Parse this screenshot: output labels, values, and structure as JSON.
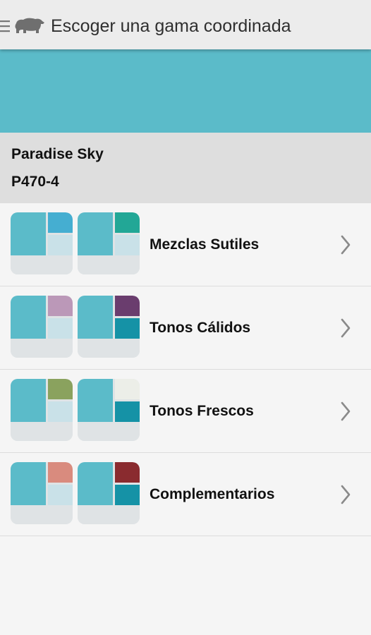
{
  "header": {
    "title": "Escoger una gama coordinada",
    "menu_icon": "hamburger-icon",
    "brand_icon": "bear-logo-icon"
  },
  "selected_color": {
    "name": "Paradise Sky",
    "code": "P470-4",
    "hex": "#5bbbc9"
  },
  "schemes": [
    {
      "label": "Mezclas Sutiles",
      "swatches": [
        {
          "main": "#5bbbc9",
          "top": "#45aed1",
          "mid": "#c9e1e8"
        },
        {
          "main": "#5bbbc9",
          "top": "#22a796",
          "mid": "#c9e1e8"
        }
      ]
    },
    {
      "label": "Tonos Cálidos",
      "swatches": [
        {
          "main": "#5bbbc9",
          "top": "#bb98b8",
          "mid": "#c9e1e8"
        },
        {
          "main": "#5bbbc9",
          "top": "#6a3d6e",
          "mid": "#1592a6"
        }
      ]
    },
    {
      "label": "Tonos Frescos",
      "swatches": [
        {
          "main": "#5bbbc9",
          "top": "#8aa25e",
          "mid": "#c9e1e8"
        },
        {
          "main": "#5bbbc9",
          "top": "#eceee8",
          "mid": "#1592a6"
        }
      ]
    },
    {
      "label": "Complementarios",
      "swatches": [
        {
          "main": "#5bbbc9",
          "top": "#d98b7e",
          "mid": "#c9e1e8"
        },
        {
          "main": "#5bbbc9",
          "top": "#8a2b2f",
          "mid": "#1592a6"
        }
      ]
    }
  ]
}
